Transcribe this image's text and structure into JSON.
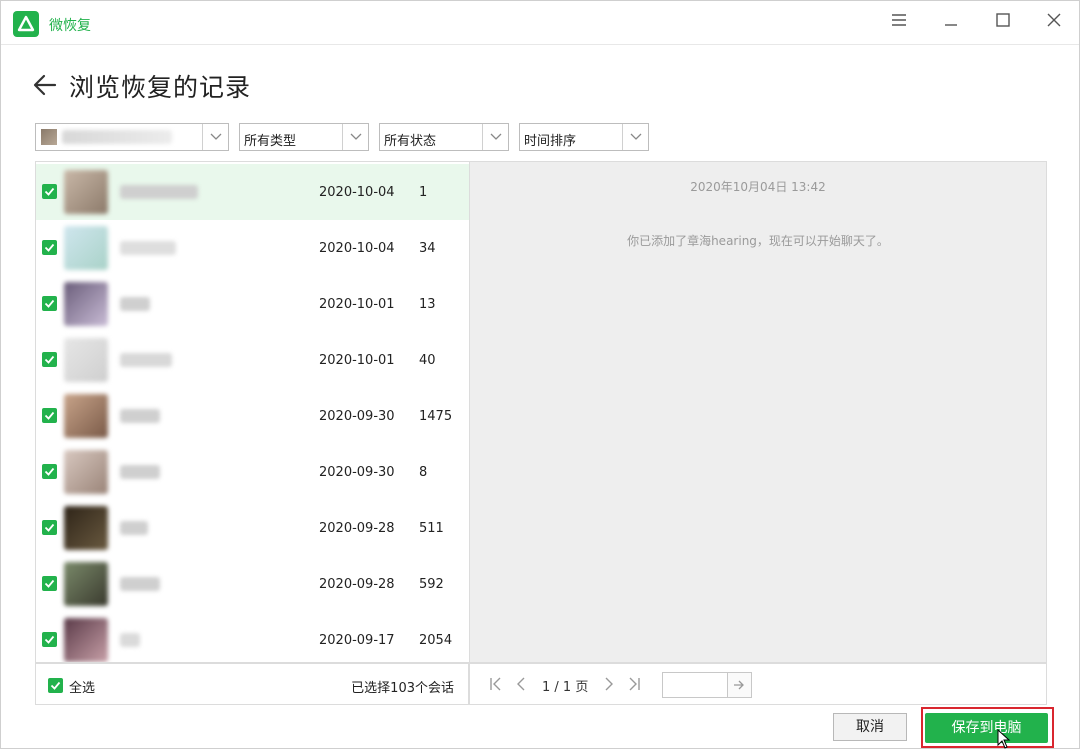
{
  "window": {
    "app_name": "微恢复",
    "menu_icon": "hamburger-menu-icon",
    "minimize_icon": "minimize-icon",
    "maximize_icon": "maximize-icon",
    "close_icon": "close-icon"
  },
  "header": {
    "back_icon": "arrow-left-icon",
    "title": "浏览恢复的记录"
  },
  "filters": {
    "account": {
      "name": ""
    },
    "type": {
      "selected": "所有类型"
    },
    "status": {
      "selected": "所有状态"
    },
    "sort": {
      "selected": "时间排序"
    }
  },
  "conversations": [
    {
      "name": "",
      "date": "2020-10-04",
      "count": "1",
      "checked": true,
      "selected": true
    },
    {
      "name": "",
      "date": "2020-10-04",
      "count": "34",
      "checked": true
    },
    {
      "name": "",
      "date": "2020-10-01",
      "count": "13",
      "checked": true
    },
    {
      "name": "",
      "date": "2020-10-01",
      "count": "40",
      "checked": true
    },
    {
      "name": "",
      "date": "2020-09-30",
      "count": "1475",
      "checked": true
    },
    {
      "name": "",
      "date": "2020-09-30",
      "count": "8",
      "checked": true
    },
    {
      "name": "",
      "date": "2020-09-28",
      "count": "511",
      "checked": true
    },
    {
      "name": "",
      "date": "2020-09-28",
      "count": "592",
      "checked": true
    },
    {
      "name": "",
      "date": "2020-09-17",
      "count": "2054",
      "checked": true
    }
  ],
  "preview": {
    "timestamp": "2020年10月04日 13:42",
    "system_message": "你已添加了章海hearing，现在可以开始聊天了。"
  },
  "list_footer": {
    "select_all_label": "全选",
    "selected_summary": "已选择103个会话"
  },
  "pagination": {
    "page_info": "1 / 1 页",
    "jump_input_value": ""
  },
  "actions": {
    "cancel_label": "取消",
    "save_label": "保存到电脑"
  },
  "colors": {
    "accent": "#22b24c",
    "selected_row": "#e9f8ec",
    "highlight_border": "#d9262f"
  }
}
